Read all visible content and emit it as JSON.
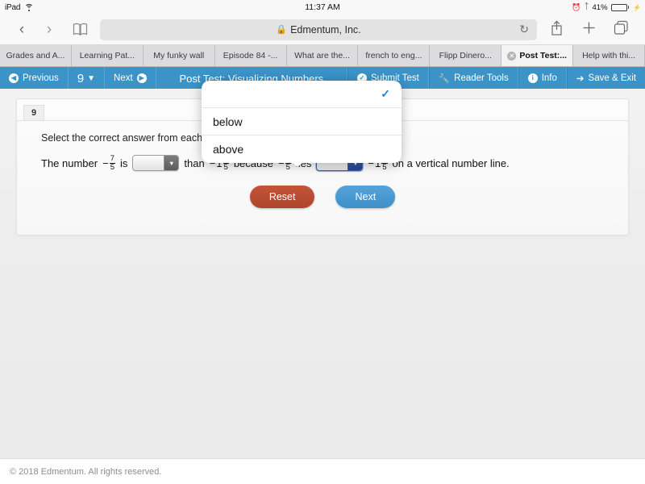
{
  "status_bar": {
    "device": "iPad",
    "wifi_icon": "wifi-icon",
    "time": "11:37 AM",
    "alarm_icon": "alarm-clock-icon",
    "bluetooth_icon": "bluetooth-icon",
    "battery_percent": "41%",
    "battery_charging": true
  },
  "browser": {
    "back_icon": "chevron-left-icon",
    "forward_icon": "chevron-right-icon",
    "bookmarks_icon": "book-icon",
    "lock_icon": "lock-icon",
    "url_text": "Edmentum, Inc.",
    "reload_icon": "reload-icon",
    "share_icon": "share-icon",
    "newtab_icon": "plus-icon",
    "tabs_icon": "tabs-icon"
  },
  "tabs": [
    {
      "label": "Grades and A...",
      "active": false,
      "has_close": false
    },
    {
      "label": "Learning Pat...",
      "active": false,
      "has_close": false
    },
    {
      "label": "My funky wall",
      "active": false,
      "has_close": false
    },
    {
      "label": "Episode 84 -...",
      "active": false,
      "has_close": false
    },
    {
      "label": "What are the...",
      "active": false,
      "has_close": false
    },
    {
      "label": "french to eng...",
      "active": false,
      "has_close": false
    },
    {
      "label": "Flipp Dinero...",
      "active": false,
      "has_close": false
    },
    {
      "label": "Post Test:...",
      "active": true,
      "has_close": true
    },
    {
      "label": "Help with thi...",
      "active": false,
      "has_close": false
    }
  ],
  "app_toolbar": {
    "previous_label": "Previous",
    "previous_icon": "arrow-left-circle-icon",
    "page_number": "9",
    "page_chevron_icon": "chevron-down-icon",
    "next_label": "Next",
    "next_icon": "arrow-right-circle-icon",
    "title": "Post Test: Visualizing Numbers",
    "submit_label": "Submit Test",
    "submit_icon": "check-circle-icon",
    "reader_label": "Reader Tools",
    "reader_icon": "wrench-icon",
    "info_label": "Info",
    "info_icon": "info-circle-icon",
    "save_exit_label": "Save & Exit",
    "save_exit_icon": "exit-arrow-icon",
    "accent_color": "#3b93c8"
  },
  "question": {
    "number": "9",
    "prompt": "Select the correct answer from each drop",
    "sentence": {
      "part1": "The number",
      "frac1": {
        "sign": "−",
        "whole": "",
        "numerator": "7",
        "denominator": "5"
      },
      "part2": "is",
      "dropdown1": {
        "value": "",
        "state": "inactive"
      },
      "part3": "than",
      "frac2": {
        "sign": "−",
        "whole": "1",
        "numerator": "1",
        "denominator": "5"
      },
      "part4": "because",
      "frac3": {
        "sign": "−",
        "whole": "",
        "numerator": "7",
        "denominator": "5"
      },
      "part5": "lies",
      "dropdown2": {
        "value": "",
        "state": "active"
      },
      "frac4": {
        "sign": "−",
        "whole": "1",
        "numerator": "1",
        "denominator": "5"
      },
      "part6": "on a vertical number line."
    },
    "reset_label": "Reset",
    "next_label": "Next",
    "reset_color": "#bb4c32",
    "next_color": "#4a97d2"
  },
  "dropdown_popover": {
    "options": [
      {
        "label": "",
        "selected": true
      },
      {
        "label": "below",
        "selected": false
      },
      {
        "label": "above",
        "selected": false
      }
    ],
    "check_icon": "check-icon",
    "check_color": "#2b7fd0"
  },
  "footer": {
    "copyright": "© 2018 Edmentum. All rights reserved."
  }
}
